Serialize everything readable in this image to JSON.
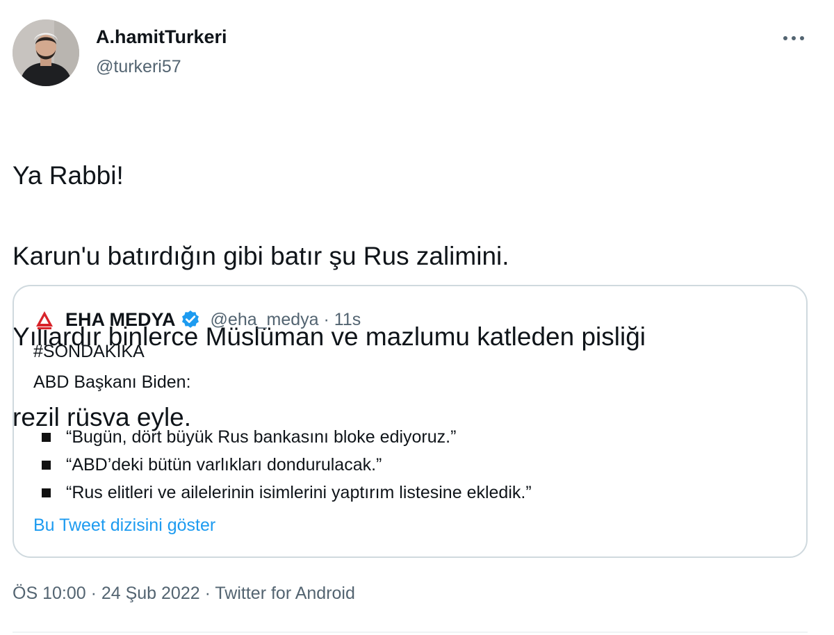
{
  "author": {
    "display_name": "A.hamitTurkeri",
    "handle": "@turkeri57",
    "avatar_icon": "profile-photo"
  },
  "more_icon": "more-horizontal-icon",
  "tweet": {
    "lines": [
      "Ya Rabbi!",
      "Karun'u batırdığın gibi batır şu Rus zalimini.",
      "Yıllardır binlerce Müslüman ve mazlumu katleden pisliği",
      "rezil rüsva eyle."
    ]
  },
  "quoted_tweet": {
    "display_name": "EHA MEDYA",
    "verified": true,
    "handle_time": "@eha_medya · 11s",
    "hashtag": "#SONDAKİKA",
    "intro": "ABD Başkanı Biden:",
    "bullets": [
      "“Bugün, dört büyük Rus bankasını bloke ediyoruz.”",
      "“ABD’deki bütün varlıkları dondurulacak.”",
      "“Rus elitleri ve ailelerinin isimlerini yaptırım listesine ekledik.”"
    ],
    "show_thread": "Bu Tweet dizisini göster"
  },
  "meta": {
    "timestamp": "ÖS 10:00 · 24 Şub 2022 · Twitter for Android"
  },
  "colors": {
    "text": "#0f1419",
    "secondary": "#536471",
    "link": "#1d9bf0",
    "border": "#cfd9de",
    "verified": "#1d9bf0",
    "eha_red": "#d8232a"
  }
}
